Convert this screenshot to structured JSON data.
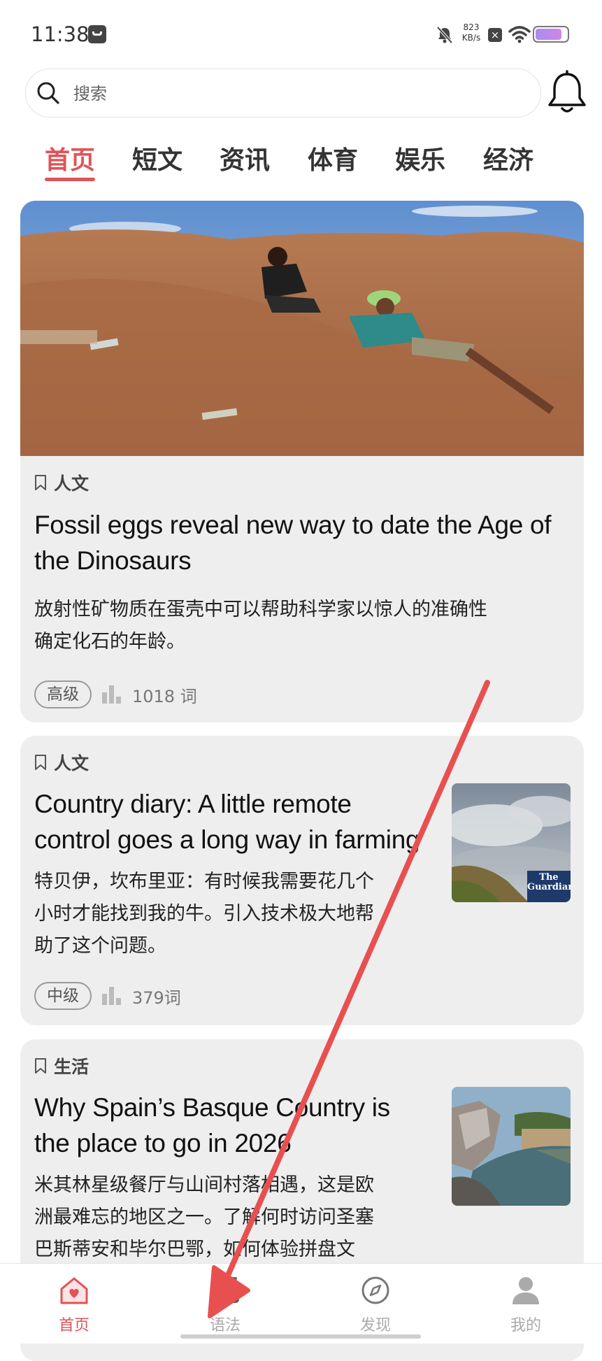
{
  "status_bar": {
    "time": "11:38",
    "net_speed_value": "823",
    "net_speed_unit": "KB/s",
    "battery_level": 0.85
  },
  "search": {
    "placeholder": "搜索"
  },
  "tabs": [
    {
      "label": "首页",
      "active": true
    },
    {
      "label": "短文"
    },
    {
      "label": "资讯"
    },
    {
      "label": "体育"
    },
    {
      "label": "娱乐"
    },
    {
      "label": "经济"
    }
  ],
  "articles": [
    {
      "category": "人文",
      "title_lines": [
        "Fossil eggs reveal new way to date the Age of",
        "the Dinosaurs"
      ],
      "desc_lines": [
        "放射性矿物质在蛋壳中可以帮助科学家以惊人的准确性",
        "确定化石的年龄。"
      ],
      "level": "高级",
      "word_count": "1018 词"
    },
    {
      "category": "人文",
      "title_lines": [
        "Country diary: A little remote",
        "control goes a long way in farming"
      ],
      "desc_lines": [
        "特贝伊，坎布里亚：有时候我需要花几个",
        "小时才能找到我的牛。引入技术极大地帮",
        "助了这个问题。"
      ],
      "level": "中级",
      "word_count": "379词",
      "thumb_logo": [
        "The",
        "Guardian"
      ]
    },
    {
      "category": "生活",
      "title_lines": [
        "Why Spain’s Basque Country is",
        "the place to go in 2026"
      ],
      "desc_lines": [
        "米其林星级餐厅与山间村落相遇，这是欧",
        "洲最难忘的地区之一。了解何时访问圣塞",
        "巴斯蒂安和毕尔巴鄂，如何体验拼盘文"
      ]
    }
  ],
  "bottom_nav": [
    {
      "label": "首页",
      "icon": "home-heart-icon",
      "active": true
    },
    {
      "label": "语法",
      "icon": "video-play-icon"
    },
    {
      "label": "发现",
      "icon": "compass-icon"
    },
    {
      "label": "我的",
      "icon": "profile-icon"
    }
  ],
  "colors": {
    "accent": "#e05358",
    "annotation_arrow": "#e8504f",
    "card_bg": "#eeeeee"
  }
}
